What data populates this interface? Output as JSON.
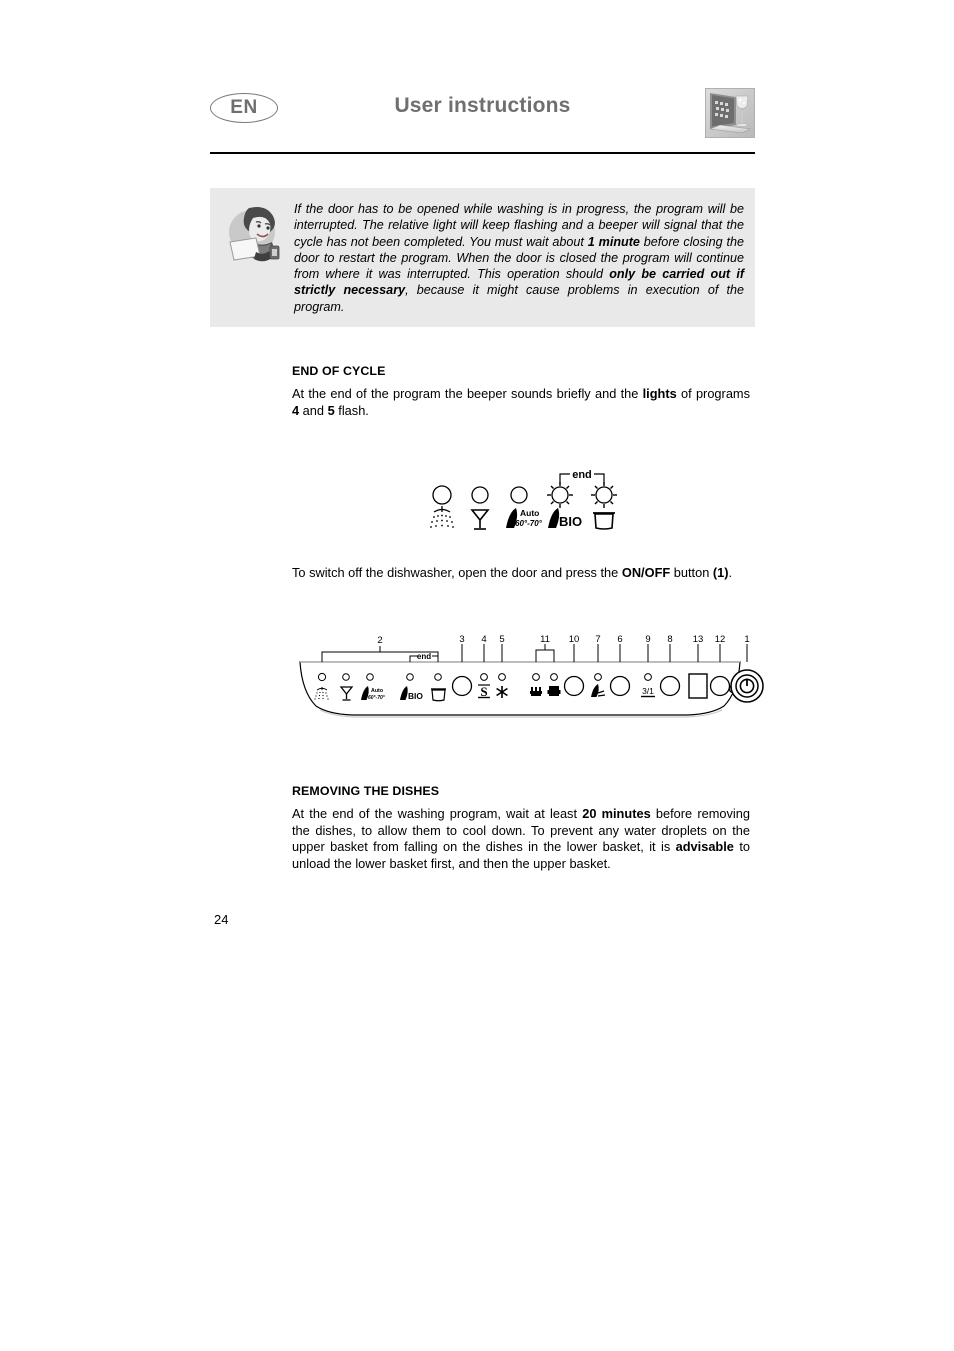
{
  "header": {
    "language_badge": "EN",
    "title": "User instructions",
    "logo_icon": "dishwasher-wineglass-image"
  },
  "note_box": {
    "icon": "person-reading-note-icon",
    "background_color": "#e9e9e9",
    "text_segments": [
      {
        "text": "If the door has to be opened while washing is in progress, the program will be interrupted. The relative light will keep flashing and a beeper will signal that the cycle has not been completed. You must wait about ",
        "bold": false
      },
      {
        "text": "1 minute",
        "bold": true
      },
      {
        "text": " before closing the door to restart the program. When the door is closed the program will continue from where it was interrupted. This operation should ",
        "bold": false
      },
      {
        "text": "only be carried out if strictly necessary",
        "bold": true
      },
      {
        "text": ", because it might cause problems in execution of the program.",
        "bold": false
      }
    ]
  },
  "sections": {
    "end_of_cycle": {
      "heading": "END OF CYCLE",
      "paragraph_segments": [
        {
          "text": "At the end of the program the beeper sounds briefly and the ",
          "bold": false
        },
        {
          "text": "lights",
          "bold": true
        },
        {
          "text": " of programs ",
          "bold": false
        },
        {
          "text": "4",
          "bold": true
        },
        {
          "text": " and ",
          "bold": false
        },
        {
          "text": "5",
          "bold": true
        },
        {
          "text": " flash.",
          "bold": false
        }
      ]
    },
    "switch_off": {
      "paragraph_segments": [
        {
          "text": "To switch off the dishwasher, open the door and press the ",
          "bold": false
        },
        {
          "text": "ON/OFF",
          "bold": true
        },
        {
          "text": " button ",
          "bold": false
        },
        {
          "text": "(1)",
          "bold": true
        },
        {
          "text": ".",
          "bold": false
        }
      ]
    },
    "removing_the_dishes": {
      "heading": "REMOVING THE DISHES",
      "paragraph_segments": [
        {
          "text": "At the end of the washing program, wait at least ",
          "bold": false
        },
        {
          "text": "20 minutes",
          "bold": true
        },
        {
          "text": " before removing the dishes, to allow them to cool down. To prevent any water droplets on the upper basket from falling on the dishes in the lower basket, it is ",
          "bold": false
        },
        {
          "text": "advisable",
          "bold": true
        },
        {
          "text": " to unload the lower basket first, and then the upper basket.",
          "bold": false
        }
      ]
    }
  },
  "figure_end_of_cycle_lights": {
    "bracket_label": "end",
    "leds": [
      {
        "program": 1,
        "icon": "spray-shower-icon",
        "state": "off",
        "icon_label": ""
      },
      {
        "program": 2,
        "icon": "wine-glass-icon",
        "state": "off",
        "icon_label": ""
      },
      {
        "program": 3,
        "icon": "auto-program-icon",
        "state": "off",
        "icon_label": "Auto 60°-70°"
      },
      {
        "program": 4,
        "icon": "bio-brush-icon",
        "state": "flashing",
        "icon_label": "BIO"
      },
      {
        "program": 5,
        "icon": "rinse-pot-icon",
        "state": "flashing",
        "icon_label": ""
      }
    ]
  },
  "figure_control_panel": {
    "bracket_label": "end",
    "callouts": [
      "2",
      "3",
      "4",
      "5",
      "11",
      "10",
      "7",
      "6",
      "9",
      "8",
      "13",
      "12",
      "1"
    ],
    "program_leds": [
      {
        "icon": "spray-shower-icon",
        "icon_label": ""
      },
      {
        "icon": "wine-glass-icon",
        "icon_label": ""
      },
      {
        "icon": "auto-program-icon",
        "icon_label": "Auto 60°-70°"
      },
      {
        "icon": "bio-brush-icon",
        "icon_label": "BIO"
      },
      {
        "icon": "rinse-pot-icon",
        "icon_label": ""
      }
    ],
    "indicators": [
      {
        "callout": "4",
        "icon": "salt-refill-icon",
        "icon_label": "S"
      },
      {
        "callout": "5",
        "icon": "rinse-aid-star-icon",
        "icon_label": ""
      },
      {
        "callout": "11",
        "icon": "upper-basket-icon",
        "icon_label": ""
      },
      {
        "callout": "11",
        "icon": "lower-basket-icon",
        "icon_label": ""
      },
      {
        "callout": "7",
        "icon": "half-load-brush-icon",
        "icon_label": ""
      },
      {
        "callout": "9",
        "icon": "three-in-one-icon",
        "icon_label": "3/1"
      }
    ],
    "buttons": [
      {
        "callout": "3",
        "name": "program-select-button"
      },
      {
        "callout": "10",
        "name": "option-button-10"
      },
      {
        "callout": "6",
        "name": "option-button-6"
      },
      {
        "callout": "8",
        "name": "option-button-8"
      },
      {
        "callout": "12",
        "name": "delay-start-button",
        "icon": "clock-icon"
      },
      {
        "callout": "1",
        "name": "on-off-button",
        "icon": "power-icon"
      }
    ],
    "display": {
      "callout": "13",
      "name": "digital-display"
    }
  },
  "page_number": "24"
}
